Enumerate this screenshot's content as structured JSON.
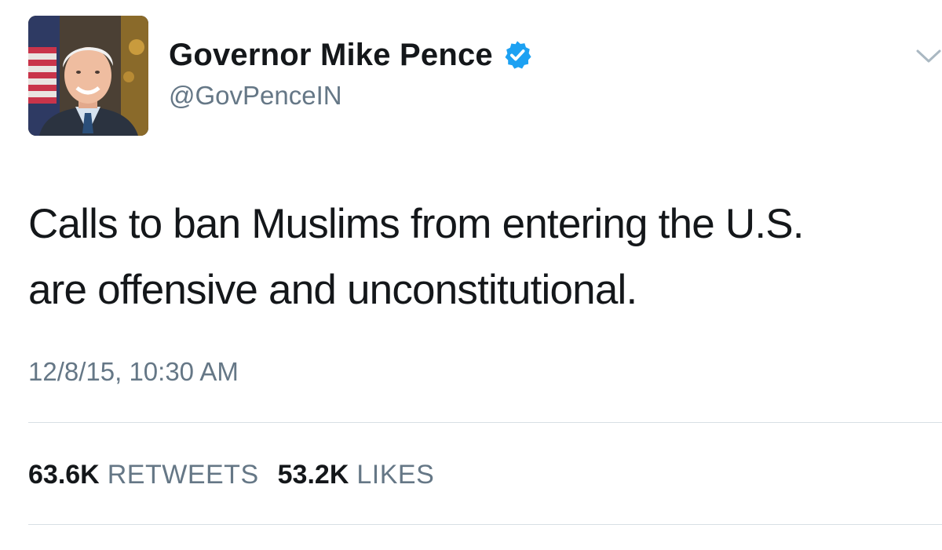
{
  "tweet": {
    "author": {
      "display_name": "Governor Mike Pence",
      "handle": "@GovPenceIN",
      "verified": true,
      "avatar_icon": "profile-photo"
    },
    "text_lines": [
      "Calls to ban Muslims from entering the U.S.",
      "are offensive and unconstitutional."
    ],
    "timestamp": "12/8/15, 10:30 AM",
    "stats": {
      "retweets_count": "63.6K",
      "retweets_label": "RETWEETS",
      "likes_count": "53.2K",
      "likes_label": "LIKES"
    },
    "menu_icon": "chevron-down-icon"
  },
  "colors": {
    "text_primary": "#14171a",
    "text_secondary": "#657786",
    "verified_blue": "#1da1f2",
    "divider": "#d8dfe4"
  }
}
